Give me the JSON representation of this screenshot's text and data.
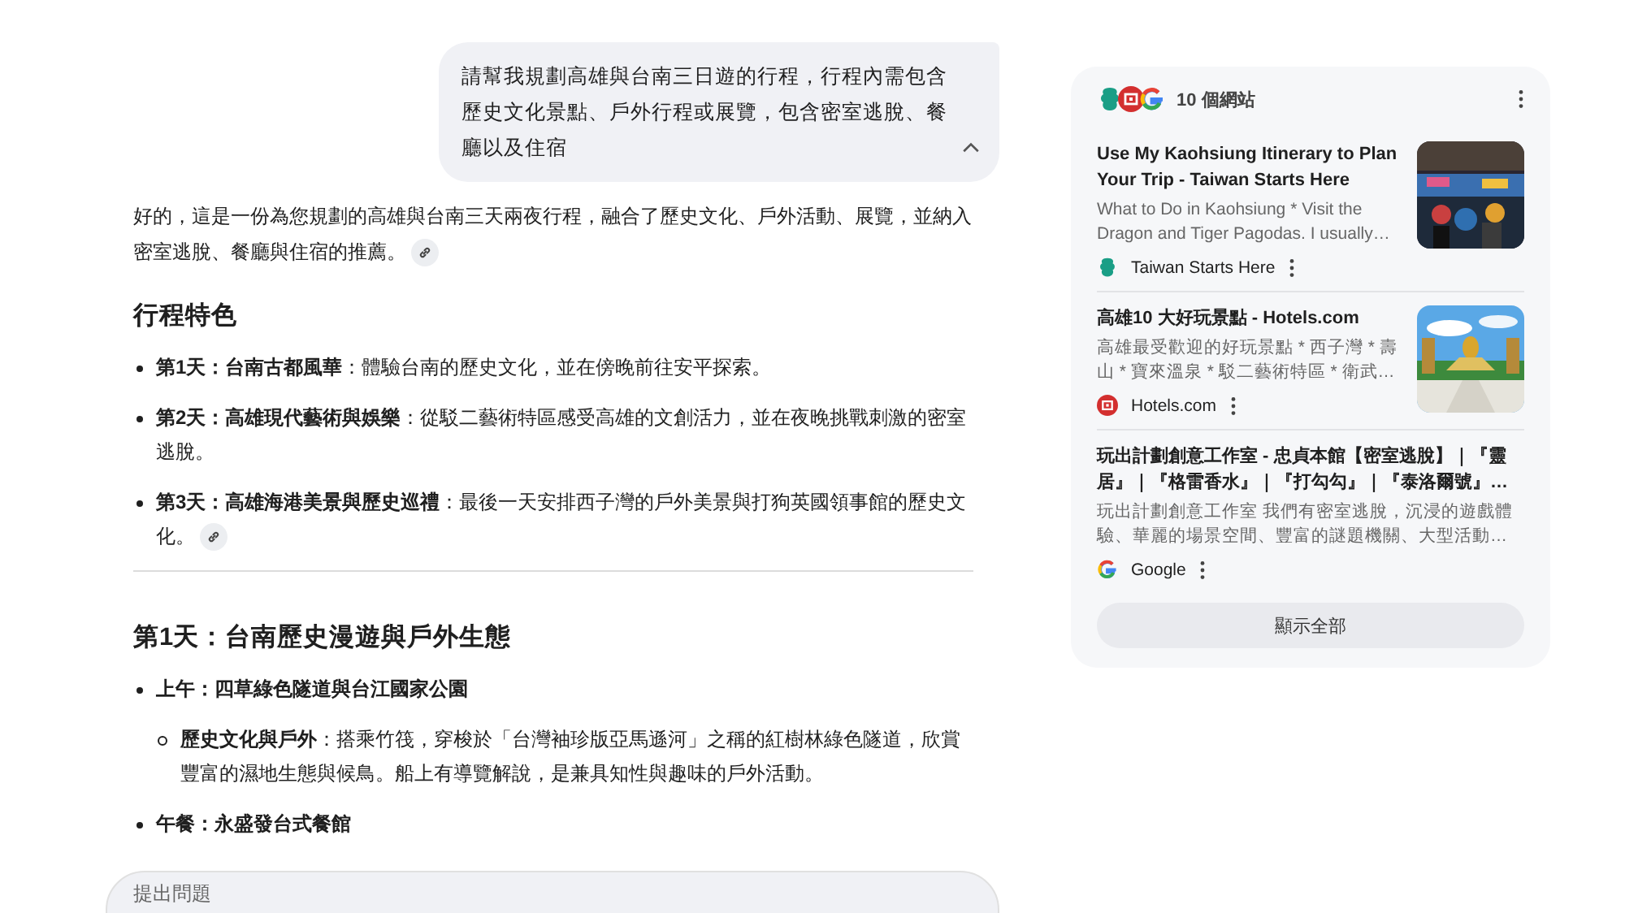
{
  "user_message": {
    "text": "請幫我規劃高雄與台南三日遊的行程，行程內需包含歷史文化景點、戶外行程或展覽，包含密室逃脫、餐廳以及住宿",
    "expanded": true
  },
  "response": [
    {
      "kind": "paragraph",
      "text": "好的，這是一份為您規劃的高雄與台南三天兩夜行程，融合了歷史文化、戶外活動、展覽，並納入密室逃脫、餐廳與住宿的推薦。",
      "citation": true
    },
    {
      "kind": "heading",
      "text": "行程特色"
    },
    {
      "kind": "bullets",
      "items": [
        {
          "text": "**第1天：台南古都風華**：體驗台南的歷史文化，並在傍晚前往安平探索。",
          "citation": false
        },
        {
          "text": "**第2天：高雄現代藝術與娛樂**：從駁二藝術特區感受高雄的文創活力，並在夜晚挑戰刺激的密室逃脫。",
          "citation": false
        },
        {
          "text": "**第3天：高雄海港美景與歷史巡禮**：最後一天安排西子灣的戶外美景與打狗英國領事館的歷史文化。",
          "citation": true
        }
      ]
    },
    {
      "kind": "divider"
    },
    {
      "kind": "heading",
      "text": "第1天：台南歷史漫遊與戶外生態"
    },
    {
      "kind": "bullets",
      "items": [
        {
          "text": "**上午：四草綠色隧道與台江國家公園**",
          "citation": false,
          "children": [
            {
              "text": "**歷史文化與戶外**：搭乘竹筏，穿梭於「台灣袖珍版亞馬遜河」之稱的紅樹林綠色隧道，欣賞豐富的濕地生態與候鳥。船上有導覽解說，是兼具知性與趣味的戶外活動。",
              "citation": false
            }
          ]
        },
        {
          "text": "**午餐：永盛發台式餐館**",
          "citation": false
        }
      ]
    }
  ],
  "prompt": {
    "placeholder": "提出問題"
  },
  "sources": {
    "count": "10 個網站",
    "logos": [
      {
        "kind": "teal"
      },
      {
        "kind": "hotels"
      },
      {
        "kind": "google"
      }
    ],
    "items": [
      {
        "title": "Use My Kaohsiung Itinerary to Plan Your Trip - Taiwan Starts Here",
        "snippet": "What to Do in Kaohsiung * Visit the Dragon and Tiger Pagodas. I usually…",
        "source": "Taiwan Starts Here",
        "site_logo": {
          "kind": "teal"
        }
      },
      {
        "title": "高雄10 大好玩景點 - Hotels.com",
        "snippet": "高雄最受歡迎的好玩景點 * 西子灣 * 壽山 * 寶來溫泉 * 駁二藝術特區 * 衛武…",
        "source": "Hotels.com",
        "site_logo": {
          "kind": "hotels"
        }
      },
      {
        "title": "玩出計劃創意工作室 - 忠貞本館【密室逃脫】｜『靈居』｜『格雷香水』｜『打勾勾』｜『泰洛爾號』…",
        "snippet": "玩出計劃創意工作室 我們有密室逃脫，沉浸的遊戲體驗、華麗的場景空間、豐富的謎題機關、大型活動…",
        "source": "Google",
        "site_logo": {
          "kind": "google"
        }
      }
    ],
    "show_all": "顯示全部"
  }
}
